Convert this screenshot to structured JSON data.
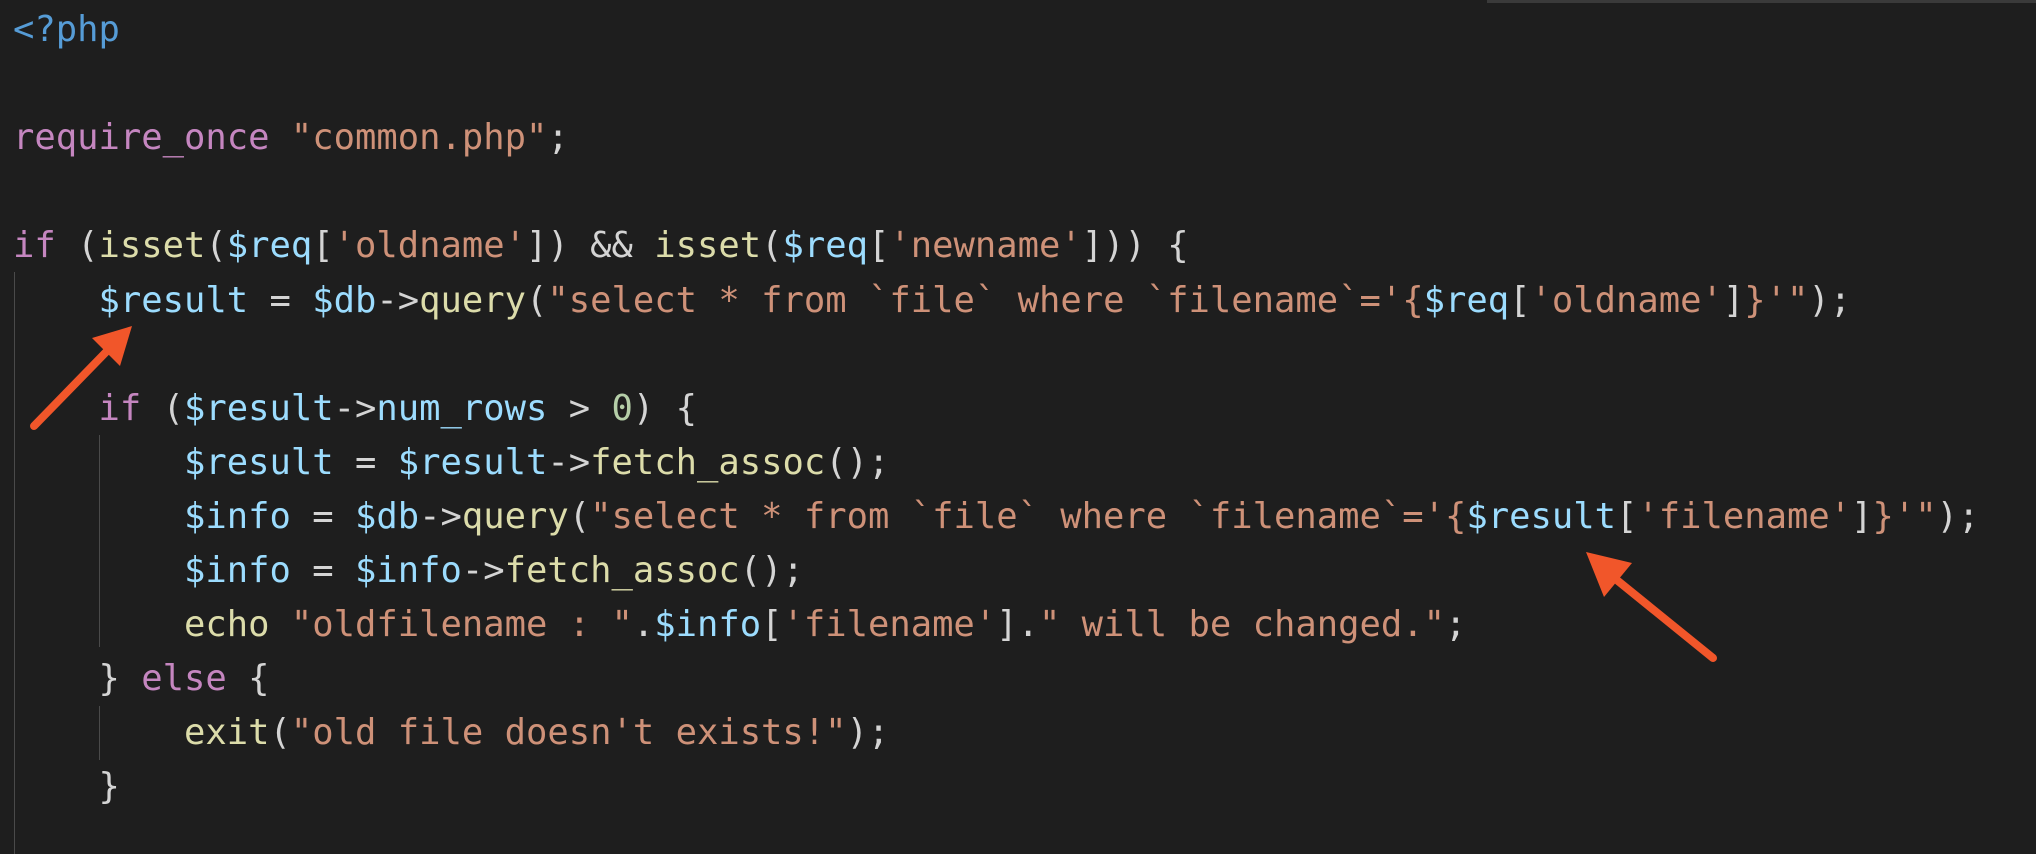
{
  "theme": {
    "background": "#1e1e1e",
    "default_text": "#d4d4d4",
    "token_colors": {
      "tag": "#569cd6",
      "keyword": "#c586c0",
      "function": "#dcdcaa",
      "variable": "#9cdcfe",
      "string": "#ce9178",
      "number": "#b5cea8"
    },
    "annotation_arrow_color": "#f1562a"
  },
  "code": {
    "language": "php",
    "lines": [
      [
        [
          "tag",
          "<?php"
        ]
      ],
      [],
      [
        [
          "keyword",
          "require_once"
        ],
        [
          "plain",
          " "
        ],
        [
          "string",
          "\"common.php\""
        ],
        [
          "plain",
          ";"
        ]
      ],
      [],
      [
        [
          "keyword",
          "if"
        ],
        [
          "plain",
          " ("
        ],
        [
          "function",
          "isset"
        ],
        [
          "plain",
          "("
        ],
        [
          "variable",
          "$req"
        ],
        [
          "plain",
          "["
        ],
        [
          "string",
          "'oldname'"
        ],
        [
          "plain",
          "]) && "
        ],
        [
          "function",
          "isset"
        ],
        [
          "plain",
          "("
        ],
        [
          "variable",
          "$req"
        ],
        [
          "plain",
          "["
        ],
        [
          "string",
          "'newname'"
        ],
        [
          "plain",
          "])) {"
        ]
      ],
      [
        [
          "plain",
          "    "
        ],
        [
          "variable",
          "$result"
        ],
        [
          "plain",
          " = "
        ],
        [
          "variable",
          "$db"
        ],
        [
          "plain",
          "->"
        ],
        [
          "function",
          "query"
        ],
        [
          "plain",
          "("
        ],
        [
          "string",
          "\"select * from `file` where `filename`='{"
        ],
        [
          "variable",
          "$req"
        ],
        [
          "plain",
          "["
        ],
        [
          "string",
          "'oldname'"
        ],
        [
          "plain",
          "]"
        ],
        [
          "string",
          "}'\""
        ],
        [
          "plain",
          ");"
        ]
      ],
      [],
      [
        [
          "plain",
          "    "
        ],
        [
          "keyword",
          "if"
        ],
        [
          "plain",
          " ("
        ],
        [
          "variable",
          "$result"
        ],
        [
          "plain",
          "->"
        ],
        [
          "variable",
          "num_rows"
        ],
        [
          "plain",
          " > "
        ],
        [
          "number",
          "0"
        ],
        [
          "plain",
          ") {"
        ]
      ],
      [
        [
          "plain",
          "        "
        ],
        [
          "variable",
          "$result"
        ],
        [
          "plain",
          " = "
        ],
        [
          "variable",
          "$result"
        ],
        [
          "plain",
          "->"
        ],
        [
          "function",
          "fetch_assoc"
        ],
        [
          "plain",
          "();"
        ]
      ],
      [
        [
          "plain",
          "        "
        ],
        [
          "variable",
          "$info"
        ],
        [
          "plain",
          " = "
        ],
        [
          "variable",
          "$db"
        ],
        [
          "plain",
          "->"
        ],
        [
          "function",
          "query"
        ],
        [
          "plain",
          "("
        ],
        [
          "string",
          "\"select * from `file` where `filename`='{"
        ],
        [
          "variable",
          "$result"
        ],
        [
          "plain",
          "["
        ],
        [
          "string",
          "'filename'"
        ],
        [
          "plain",
          "]"
        ],
        [
          "string",
          "}'\""
        ],
        [
          "plain",
          ");"
        ]
      ],
      [
        [
          "plain",
          "        "
        ],
        [
          "variable",
          "$info"
        ],
        [
          "plain",
          " = "
        ],
        [
          "variable",
          "$info"
        ],
        [
          "plain",
          "->"
        ],
        [
          "function",
          "fetch_assoc"
        ],
        [
          "plain",
          "();"
        ]
      ],
      [
        [
          "plain",
          "        "
        ],
        [
          "function",
          "echo"
        ],
        [
          "plain",
          " "
        ],
        [
          "string",
          "\"oldfilename : \""
        ],
        [
          "plain",
          "."
        ],
        [
          "variable",
          "$info"
        ],
        [
          "plain",
          "["
        ],
        [
          "string",
          "'filename'"
        ],
        [
          "plain",
          "]."
        ],
        [
          "string",
          "\" will be changed.\""
        ],
        [
          "plain",
          ";"
        ]
      ],
      [
        [
          "plain",
          "    } "
        ],
        [
          "keyword",
          "else"
        ],
        [
          "plain",
          " {"
        ]
      ],
      [
        [
          "plain",
          "        "
        ],
        [
          "function",
          "exit"
        ],
        [
          "plain",
          "("
        ],
        [
          "string",
          "\"old file doesn't exists!\""
        ],
        [
          "plain",
          ");"
        ]
      ],
      [
        [
          "plain",
          "    }"
        ]
      ]
    ]
  }
}
